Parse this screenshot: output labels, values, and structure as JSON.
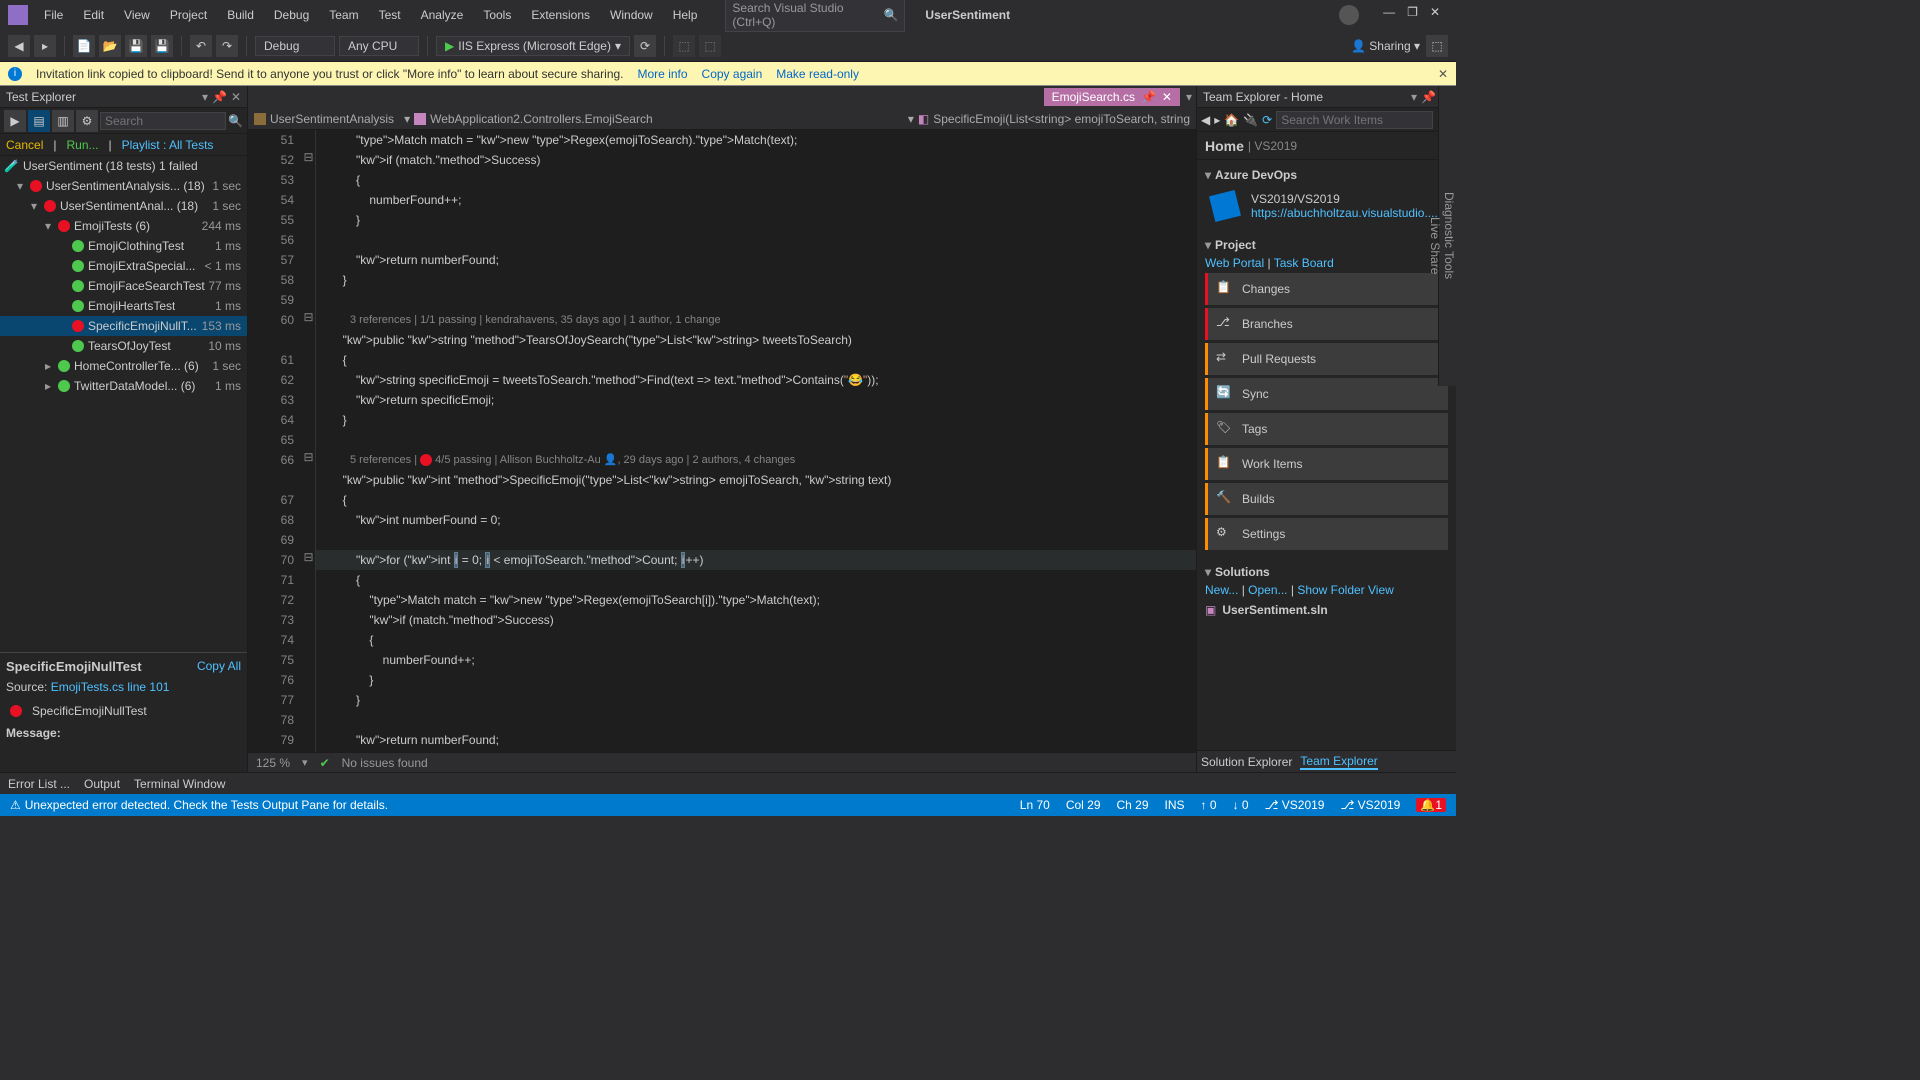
{
  "menu": [
    "File",
    "Edit",
    "View",
    "Project",
    "Build",
    "Debug",
    "Team",
    "Test",
    "Analyze",
    "Tools",
    "Extensions",
    "Window",
    "Help"
  ],
  "search_vs_placeholder": "Search Visual Studio (Ctrl+Q)",
  "solution_name": "UserSentiment",
  "toolbar": {
    "config": "Debug",
    "platform": "Any CPU",
    "run": "IIS Express (Microsoft Edge)",
    "sharing": "Sharing"
  },
  "infobar": {
    "text": "Invitation link copied to clipboard! Send it to anyone you trust or click \"More info\" to learn about secure sharing.",
    "more": "More info",
    "copy": "Copy again",
    "readonly": "Make read-only"
  },
  "test_explorer": {
    "title": "Test Explorer",
    "search_placeholder": "Search",
    "cancel": "Cancel",
    "run": "Run...",
    "playlist": "Playlist : All Tests",
    "root": {
      "name": "UserSentiment (18 tests) 1 failed"
    },
    "nodes": [
      {
        "depth": 1,
        "exp": "▾",
        "icon": "fail",
        "name": "UserSentimentAnalysis... (18)",
        "dur": "1 sec"
      },
      {
        "depth": 2,
        "exp": "▾",
        "icon": "fail",
        "name": "UserSentimentAnal... (18)",
        "dur": "1 sec"
      },
      {
        "depth": 3,
        "exp": "▾",
        "icon": "fail",
        "name": "EmojiTests (6)",
        "dur": "244 ms"
      },
      {
        "depth": 4,
        "exp": "",
        "icon": "pass",
        "name": "EmojiClothingTest",
        "dur": "1 ms"
      },
      {
        "depth": 4,
        "exp": "",
        "icon": "pass",
        "name": "EmojiExtraSpecial...",
        "dur": "< 1 ms"
      },
      {
        "depth": 4,
        "exp": "",
        "icon": "pass",
        "name": "EmojiFaceSearchTest",
        "dur": "77 ms"
      },
      {
        "depth": 4,
        "exp": "",
        "icon": "pass",
        "name": "EmojiHeartsTest",
        "dur": "1 ms"
      },
      {
        "depth": 4,
        "exp": "",
        "icon": "fail",
        "name": "SpecificEmojiNullT...",
        "dur": "153 ms",
        "sel": true
      },
      {
        "depth": 4,
        "exp": "",
        "icon": "pass",
        "name": "TearsOfJoyTest",
        "dur": "10 ms"
      },
      {
        "depth": 3,
        "exp": "▸",
        "icon": "pass",
        "name": "HomeControllerTe... (6)",
        "dur": "1 sec"
      },
      {
        "depth": 3,
        "exp": "▸",
        "icon": "pass",
        "name": "TwitterDataModel... (6)",
        "dur": "1 ms"
      }
    ],
    "detail": {
      "title": "SpecificEmojiNullTest",
      "copy": "Copy All",
      "source_lbl": "Source:",
      "source": "EmojiTests.cs line 101",
      "fail_name": "SpecificEmojiNullTest",
      "msg_lbl": "Message:"
    }
  },
  "editor": {
    "tab": "EmojiSearch.cs",
    "breadcrumbs": [
      "UserSentimentAnalysis",
      "WebApplication2.Controllers.EmojiSearch",
      "SpecificEmoji(List<string> emojiToSearch, string"
    ],
    "lines_start": 51,
    "codelens1": "3 references | 1/1 passing | kendrahavens, 35 days ago | 1 author, 1 change",
    "codelens2_a": "5 references | ",
    "codelens2_b": " 4/5 passing | Allison Buchholtz-Au ",
    "codelens2_c": ", 29 days ago | 2 authors, 4 changes",
    "code": [
      {
        "n": 51,
        "t": "            Match match = new Regex(emojiToSearch).Match(text);"
      },
      {
        "n": 52,
        "t": "            if (match.Success)"
      },
      {
        "n": 53,
        "t": "            {"
      },
      {
        "n": 54,
        "t": "                numberFound++;"
      },
      {
        "n": 55,
        "t": "            }"
      },
      {
        "n": 56,
        "t": ""
      },
      {
        "n": 57,
        "t": "            return numberFound;"
      },
      {
        "n": 58,
        "t": "        }"
      },
      {
        "n": 59,
        "t": ""
      },
      {
        "n": 60,
        "t": "        public string TearsOfJoySearch(List<string> tweetsToSearch)"
      },
      {
        "n": 61,
        "t": "        {"
      },
      {
        "n": 62,
        "t": "            string specificEmoji = tweetsToSearch.Find(text => text.Contains(\"😂\"));"
      },
      {
        "n": 63,
        "t": "            return specificEmoji;"
      },
      {
        "n": 64,
        "t": "        }"
      },
      {
        "n": 65,
        "t": ""
      },
      {
        "n": 66,
        "t": "        public int SpecificEmoji(List<string> emojiToSearch, string text)"
      },
      {
        "n": 67,
        "t": "        {"
      },
      {
        "n": 68,
        "t": "            int numberFound = 0;"
      },
      {
        "n": 69,
        "t": ""
      },
      {
        "n": 70,
        "t": "            for (int i = 0; i < emojiToSearch.Count; i++)",
        "current": true
      },
      {
        "n": 71,
        "t": "            {"
      },
      {
        "n": 72,
        "t": "                Match match = new Regex(emojiToSearch[i]).Match(text);"
      },
      {
        "n": 73,
        "t": "                if (match.Success)"
      },
      {
        "n": 74,
        "t": "                {"
      },
      {
        "n": 75,
        "t": "                    numberFound++;"
      },
      {
        "n": 76,
        "t": "                }"
      },
      {
        "n": 77,
        "t": "            }"
      },
      {
        "n": 78,
        "t": ""
      },
      {
        "n": 79,
        "t": "            return numberFound;"
      }
    ],
    "status": {
      "zoom": "125 %",
      "issues": "No issues found"
    }
  },
  "team_explorer": {
    "title": "Team Explorer - Home",
    "search_placeholder": "Search Work Items",
    "home": "Home",
    "sub": "| VS2019",
    "azdo": {
      "hdr": "Azure DevOps",
      "name": "VS2019/VS2019",
      "url": "https://abuchholtzau.visualstudio...."
    },
    "project_hdr": "Project",
    "portal": "Web Portal",
    "taskboard": "Task Board",
    "items": [
      "Changes",
      "Branches",
      "Pull Requests",
      "Sync",
      "Tags",
      "Work Items",
      "Builds",
      "Settings"
    ],
    "solutions_hdr": "Solutions",
    "new": "New...",
    "open": "Open...",
    "sfv": "Show Folder View",
    "sln": "UserSentiment.sln",
    "tabs": [
      "Solution Explorer",
      "Team Explorer"
    ]
  },
  "output_tabs": [
    "Error List ...",
    "Output",
    "Terminal Window"
  ],
  "rail": [
    "Diagnostic Tools",
    "Live Share"
  ],
  "statusbar": {
    "error": "Unexpected error detected. Check the Tests Output Pane for details.",
    "ln": "Ln 70",
    "col": "Col 29",
    "ch": "Ch 29",
    "ins": "INS",
    "up": "0",
    "down": "0",
    "repo": "VS2019",
    "branch": "VS2019",
    "notif": "1"
  }
}
